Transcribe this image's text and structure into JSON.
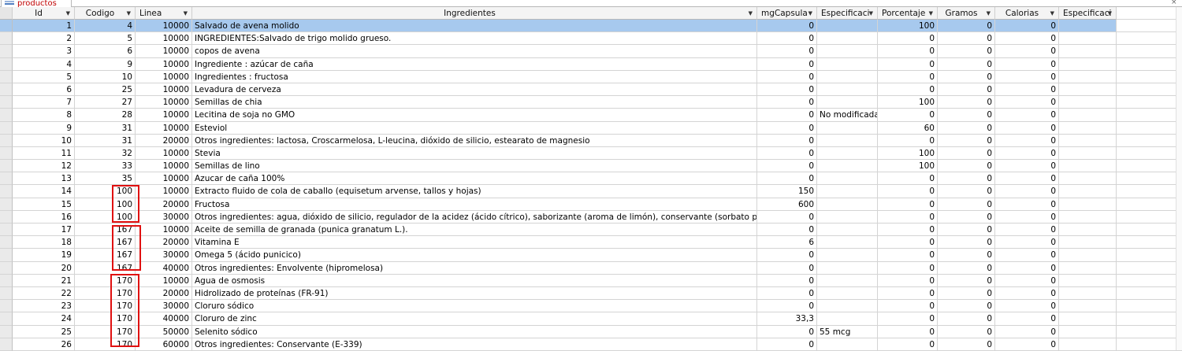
{
  "tab": {
    "label": "productos"
  },
  "columns": [
    {
      "key": "id",
      "label": "Id"
    },
    {
      "key": "codigo",
      "label": "Codigo"
    },
    {
      "key": "linea",
      "label": "Linea"
    },
    {
      "key": "ingredientes",
      "label": "Ingredientes"
    },
    {
      "key": "mgcapsula",
      "label": "mgCapsula"
    },
    {
      "key": "especificacion",
      "label": "Especificaci"
    },
    {
      "key": "porcentaje",
      "label": "Porcentaje"
    },
    {
      "key": "gramos",
      "label": "Gramos"
    },
    {
      "key": "calorias",
      "label": "Calorias"
    },
    {
      "key": "especificacion2",
      "label": "Especificaci"
    }
  ],
  "rows": [
    {
      "id": "1",
      "codigo": "4",
      "linea": "10000",
      "ingredientes": "Salvado de avena molido",
      "mgcapsula": "0",
      "especificacion": "",
      "porcentaje": "100",
      "gramos": "0",
      "calorias": "0",
      "especificacion2": ""
    },
    {
      "id": "2",
      "codigo": "5",
      "linea": "10000",
      "ingredientes": "INGREDIENTES:Salvado de trigo molido grueso.",
      "mgcapsula": "0",
      "especificacion": "",
      "porcentaje": "0",
      "gramos": "0",
      "calorias": "0",
      "especificacion2": ""
    },
    {
      "id": "3",
      "codigo": "6",
      "linea": "10000",
      "ingredientes": "copos  de avena",
      "mgcapsula": "0",
      "especificacion": "",
      "porcentaje": "0",
      "gramos": "0",
      "calorias": "0",
      "especificacion2": ""
    },
    {
      "id": "4",
      "codigo": "9",
      "linea": "10000",
      "ingredientes": "Ingrediente : azúcar de caña",
      "mgcapsula": "0",
      "especificacion": "",
      "porcentaje": "0",
      "gramos": "0",
      "calorias": "0",
      "especificacion2": ""
    },
    {
      "id": "5",
      "codigo": "10",
      "linea": "10000",
      "ingredientes": "Ingredientes : fructosa",
      "mgcapsula": "0",
      "especificacion": "",
      "porcentaje": "0",
      "gramos": "0",
      "calorias": "0",
      "especificacion2": ""
    },
    {
      "id": "6",
      "codigo": "25",
      "linea": "10000",
      "ingredientes": "Levadura de cerveza",
      "mgcapsula": "0",
      "especificacion": "",
      "porcentaje": "0",
      "gramos": "0",
      "calorias": "0",
      "especificacion2": ""
    },
    {
      "id": "7",
      "codigo": "27",
      "linea": "10000",
      "ingredientes": "Semillas de chia",
      "mgcapsula": "0",
      "especificacion": "",
      "porcentaje": "100",
      "gramos": "0",
      "calorias": "0",
      "especificacion2": ""
    },
    {
      "id": "8",
      "codigo": "28",
      "linea": "10000",
      "ingredientes": "Lecitina de soja no GMO",
      "mgcapsula": "0",
      "especificacion": "No modificada",
      "porcentaje": "0",
      "gramos": "0",
      "calorias": "0",
      "especificacion2": ""
    },
    {
      "id": "9",
      "codigo": "31",
      "linea": "10000",
      "ingredientes": "Esteviol",
      "mgcapsula": "0",
      "especificacion": "",
      "porcentaje": "60",
      "gramos": "0",
      "calorias": "0",
      "especificacion2": ""
    },
    {
      "id": "10",
      "codigo": "31",
      "linea": "20000",
      "ingredientes": "Otros ingredientes: lactosa, Croscarmelosa, L-leucina, dióxido de silicio, estearato de magnesio",
      "mgcapsula": "0",
      "especificacion": "",
      "porcentaje": "0",
      "gramos": "0",
      "calorias": "0",
      "especificacion2": ""
    },
    {
      "id": "11",
      "codigo": "32",
      "linea": "10000",
      "ingredientes": "Stevia",
      "mgcapsula": "0",
      "especificacion": "",
      "porcentaje": "100",
      "gramos": "0",
      "calorias": "0",
      "especificacion2": ""
    },
    {
      "id": "12",
      "codigo": "33",
      "linea": "10000",
      "ingredientes": "Semillas de lino",
      "mgcapsula": "0",
      "especificacion": "",
      "porcentaje": "100",
      "gramos": "0",
      "calorias": "0",
      "especificacion2": ""
    },
    {
      "id": "13",
      "codigo": "35",
      "linea": "10000",
      "ingredientes": "Azucar de caña 100%",
      "mgcapsula": "0",
      "especificacion": "",
      "porcentaje": "0",
      "gramos": "0",
      "calorias": "0",
      "especificacion2": ""
    },
    {
      "id": "14",
      "codigo": "100",
      "linea": "10000",
      "ingredientes": "Extracto fluido de cola de caballo (equisetum arvense, tallos y hojas)",
      "mgcapsula": "150",
      "especificacion": "",
      "porcentaje": "0",
      "gramos": "0",
      "calorias": "0",
      "especificacion2": ""
    },
    {
      "id": "15",
      "codigo": "100",
      "linea": "20000",
      "ingredientes": "Fructosa",
      "mgcapsula": "600",
      "especificacion": "",
      "porcentaje": "0",
      "gramos": "0",
      "calorias": "0",
      "especificacion2": ""
    },
    {
      "id": "16",
      "codigo": "100",
      "linea": "30000",
      "ingredientes": "Otros ingredientes: agua, dióxido de silicio, regulador de la acidez (ácido cítrico), saborizante (aroma de limón), conservante (sorbato potásico)",
      "mgcapsula": "0",
      "especificacion": "",
      "porcentaje": "0",
      "gramos": "0",
      "calorias": "0",
      "especificacion2": ""
    },
    {
      "id": "17",
      "codigo": "167",
      "linea": "10000",
      "ingredientes": "Aceite de semilla de granada (punica granatum L.).",
      "mgcapsula": "0",
      "especificacion": "",
      "porcentaje": "0",
      "gramos": "0",
      "calorias": "0",
      "especificacion2": ""
    },
    {
      "id": "18",
      "codigo": "167",
      "linea": "20000",
      "ingredientes": "Vitamina E",
      "mgcapsula": "6",
      "especificacion": "",
      "porcentaje": "0",
      "gramos": "0",
      "calorias": "0",
      "especificacion2": ""
    },
    {
      "id": "19",
      "codigo": "167",
      "linea": "30000",
      "ingredientes": "Omega 5 (ácido punicico)",
      "mgcapsula": "0",
      "especificacion": "",
      "porcentaje": "0",
      "gramos": "0",
      "calorias": "0",
      "especificacion2": ""
    },
    {
      "id": "20",
      "codigo": "167",
      "linea": "40000",
      "ingredientes": "Otros ingredientes: Envolvente (hipromelosa)",
      "mgcapsula": "0",
      "especificacion": "",
      "porcentaje": "0",
      "gramos": "0",
      "calorias": "0",
      "especificacion2": ""
    },
    {
      "id": "21",
      "codigo": "170",
      "linea": "10000",
      "ingredientes": "Agua de osmosis",
      "mgcapsula": "0",
      "especificacion": "",
      "porcentaje": "0",
      "gramos": "0",
      "calorias": "0",
      "especificacion2": ""
    },
    {
      "id": "22",
      "codigo": "170",
      "linea": "20000",
      "ingredientes": "Hidrolizado de proteínas (FR-91)",
      "mgcapsula": "0",
      "especificacion": "",
      "porcentaje": "0",
      "gramos": "0",
      "calorias": "0",
      "especificacion2": ""
    },
    {
      "id": "23",
      "codigo": "170",
      "linea": "30000",
      "ingredientes": "Cloruro sódico",
      "mgcapsula": "0",
      "especificacion": "",
      "porcentaje": "0",
      "gramos": "0",
      "calorias": "0",
      "especificacion2": ""
    },
    {
      "id": "24",
      "codigo": "170",
      "linea": "40000",
      "ingredientes": "Cloruro de zinc",
      "mgcapsula": "33,3",
      "especificacion": "",
      "porcentaje": "0",
      "gramos": "0",
      "calorias": "0",
      "especificacion2": ""
    },
    {
      "id": "25",
      "codigo": "170",
      "linea": "50000",
      "ingredientes": "Selenito sódico",
      "mgcapsula": "0",
      "especificacion": "55 mcg",
      "porcentaje": "0",
      "gramos": "0",
      "calorias": "0",
      "especificacion2": ""
    },
    {
      "id": "26",
      "codigo": "170",
      "linea": "60000",
      "ingredientes": "Otros ingredientes: Conservante (E-339)",
      "mgcapsula": "0",
      "especificacion": "",
      "porcentaje": "0",
      "gramos": "0",
      "calorias": "0",
      "especificacion2": ""
    }
  ]
}
